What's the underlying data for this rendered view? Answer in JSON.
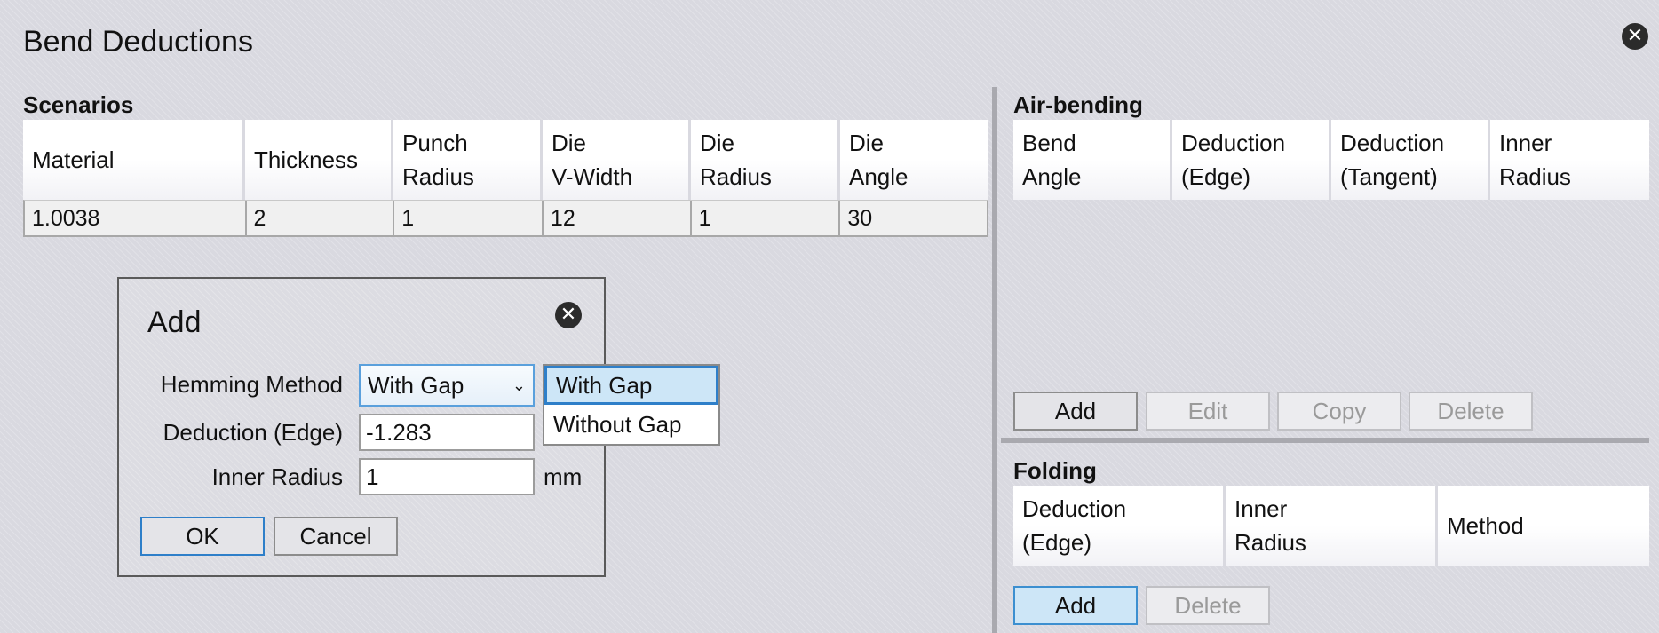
{
  "window": {
    "title": "Bend Deductions"
  },
  "scenarios": {
    "label": "Scenarios",
    "columns": [
      "Material",
      "Thickness",
      "Punch\nRadius",
      "Die\nV-Width",
      "Die\nRadius",
      "Die\nAngle"
    ],
    "rows": [
      [
        "1.0038",
        "2",
        "1",
        "12",
        "1",
        "30"
      ]
    ]
  },
  "air_bending": {
    "label": "Air-bending",
    "columns": [
      "Bend\nAngle",
      "Deduction\n(Edge)",
      "Deduction\n(Tangent)",
      "Inner\nRadius"
    ],
    "buttons": {
      "add": "Add",
      "edit": "Edit",
      "copy": "Copy",
      "delete": "Delete"
    }
  },
  "folding": {
    "label": "Folding",
    "columns": [
      "Deduction\n(Edge)",
      "Inner\nRadius",
      "Method"
    ],
    "buttons": {
      "add": "Add",
      "delete": "Delete"
    }
  },
  "add_dialog": {
    "title": "Add",
    "hemming_method_label": "Hemming Method",
    "hemming_method_value": "With Gap",
    "hemming_options": [
      "With Gap",
      "Without Gap"
    ],
    "deduction_edge_label": "Deduction (Edge)",
    "deduction_edge_value": "-1.283",
    "inner_radius_label": "Inner Radius",
    "inner_radius_value": "1",
    "inner_radius_unit": "mm",
    "ok": "OK",
    "cancel": "Cancel"
  },
  "icons": {
    "close": "close-icon",
    "dropdown": "chevron-down-icon"
  },
  "colors": {
    "accent": "#2e7fc9",
    "selection": "#cde6f7"
  }
}
